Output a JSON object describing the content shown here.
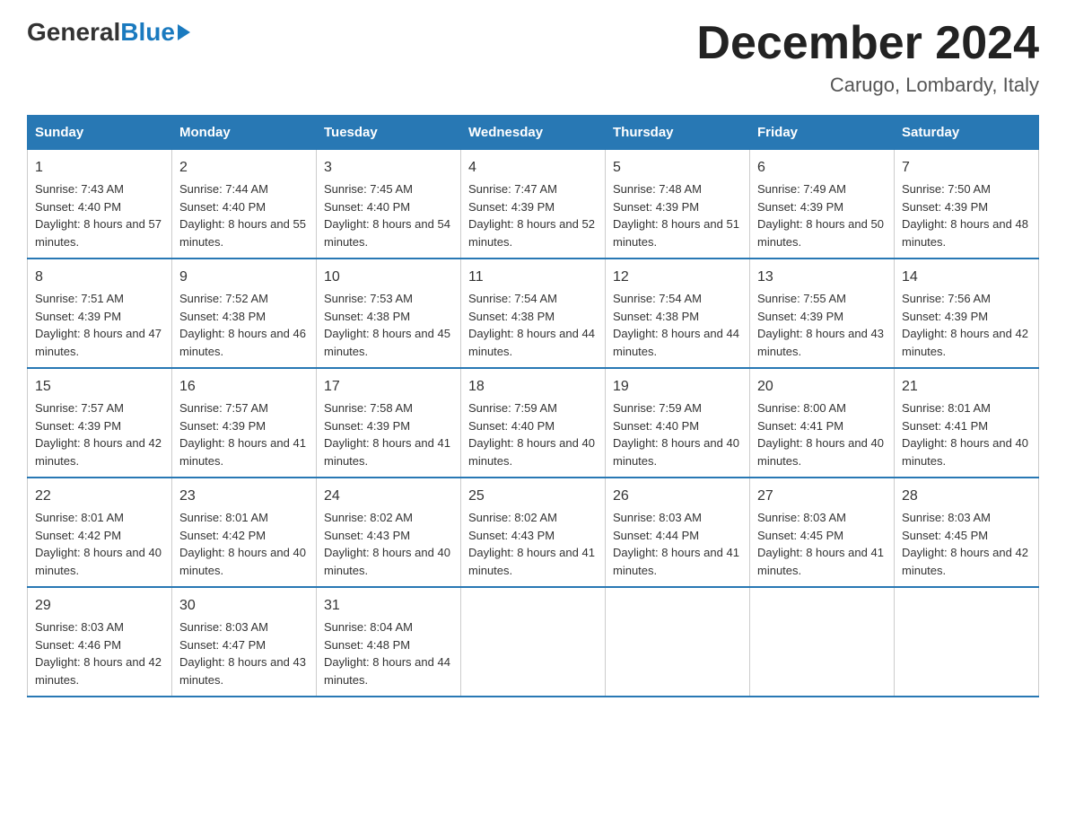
{
  "logo": {
    "general": "General",
    "blue": "Blue"
  },
  "title": "December 2024",
  "location": "Carugo, Lombardy, Italy",
  "days_of_week": [
    "Sunday",
    "Monday",
    "Tuesday",
    "Wednesday",
    "Thursday",
    "Friday",
    "Saturday"
  ],
  "weeks": [
    [
      {
        "day": "1",
        "sunrise": "7:43 AM",
        "sunset": "4:40 PM",
        "daylight": "8 hours and 57 minutes."
      },
      {
        "day": "2",
        "sunrise": "7:44 AM",
        "sunset": "4:40 PM",
        "daylight": "8 hours and 55 minutes."
      },
      {
        "day": "3",
        "sunrise": "7:45 AM",
        "sunset": "4:40 PM",
        "daylight": "8 hours and 54 minutes."
      },
      {
        "day": "4",
        "sunrise": "7:47 AM",
        "sunset": "4:39 PM",
        "daylight": "8 hours and 52 minutes."
      },
      {
        "day": "5",
        "sunrise": "7:48 AM",
        "sunset": "4:39 PM",
        "daylight": "8 hours and 51 minutes."
      },
      {
        "day": "6",
        "sunrise": "7:49 AM",
        "sunset": "4:39 PM",
        "daylight": "8 hours and 50 minutes."
      },
      {
        "day": "7",
        "sunrise": "7:50 AM",
        "sunset": "4:39 PM",
        "daylight": "8 hours and 48 minutes."
      }
    ],
    [
      {
        "day": "8",
        "sunrise": "7:51 AM",
        "sunset": "4:39 PM",
        "daylight": "8 hours and 47 minutes."
      },
      {
        "day": "9",
        "sunrise": "7:52 AM",
        "sunset": "4:38 PM",
        "daylight": "8 hours and 46 minutes."
      },
      {
        "day": "10",
        "sunrise": "7:53 AM",
        "sunset": "4:38 PM",
        "daylight": "8 hours and 45 minutes."
      },
      {
        "day": "11",
        "sunrise": "7:54 AM",
        "sunset": "4:38 PM",
        "daylight": "8 hours and 44 minutes."
      },
      {
        "day": "12",
        "sunrise": "7:54 AM",
        "sunset": "4:38 PM",
        "daylight": "8 hours and 44 minutes."
      },
      {
        "day": "13",
        "sunrise": "7:55 AM",
        "sunset": "4:39 PM",
        "daylight": "8 hours and 43 minutes."
      },
      {
        "day": "14",
        "sunrise": "7:56 AM",
        "sunset": "4:39 PM",
        "daylight": "8 hours and 42 minutes."
      }
    ],
    [
      {
        "day": "15",
        "sunrise": "7:57 AM",
        "sunset": "4:39 PM",
        "daylight": "8 hours and 42 minutes."
      },
      {
        "day": "16",
        "sunrise": "7:57 AM",
        "sunset": "4:39 PM",
        "daylight": "8 hours and 41 minutes."
      },
      {
        "day": "17",
        "sunrise": "7:58 AM",
        "sunset": "4:39 PM",
        "daylight": "8 hours and 41 minutes."
      },
      {
        "day": "18",
        "sunrise": "7:59 AM",
        "sunset": "4:40 PM",
        "daylight": "8 hours and 40 minutes."
      },
      {
        "day": "19",
        "sunrise": "7:59 AM",
        "sunset": "4:40 PM",
        "daylight": "8 hours and 40 minutes."
      },
      {
        "day": "20",
        "sunrise": "8:00 AM",
        "sunset": "4:41 PM",
        "daylight": "8 hours and 40 minutes."
      },
      {
        "day": "21",
        "sunrise": "8:01 AM",
        "sunset": "4:41 PM",
        "daylight": "8 hours and 40 minutes."
      }
    ],
    [
      {
        "day": "22",
        "sunrise": "8:01 AM",
        "sunset": "4:42 PM",
        "daylight": "8 hours and 40 minutes."
      },
      {
        "day": "23",
        "sunrise": "8:01 AM",
        "sunset": "4:42 PM",
        "daylight": "8 hours and 40 minutes."
      },
      {
        "day": "24",
        "sunrise": "8:02 AM",
        "sunset": "4:43 PM",
        "daylight": "8 hours and 40 minutes."
      },
      {
        "day": "25",
        "sunrise": "8:02 AM",
        "sunset": "4:43 PM",
        "daylight": "8 hours and 41 minutes."
      },
      {
        "day": "26",
        "sunrise": "8:03 AM",
        "sunset": "4:44 PM",
        "daylight": "8 hours and 41 minutes."
      },
      {
        "day": "27",
        "sunrise": "8:03 AM",
        "sunset": "4:45 PM",
        "daylight": "8 hours and 41 minutes."
      },
      {
        "day": "28",
        "sunrise": "8:03 AM",
        "sunset": "4:45 PM",
        "daylight": "8 hours and 42 minutes."
      }
    ],
    [
      {
        "day": "29",
        "sunrise": "8:03 AM",
        "sunset": "4:46 PM",
        "daylight": "8 hours and 42 minutes."
      },
      {
        "day": "30",
        "sunrise": "8:03 AM",
        "sunset": "4:47 PM",
        "daylight": "8 hours and 43 minutes."
      },
      {
        "day": "31",
        "sunrise": "8:04 AM",
        "sunset": "4:48 PM",
        "daylight": "8 hours and 44 minutes."
      },
      null,
      null,
      null,
      null
    ]
  ]
}
